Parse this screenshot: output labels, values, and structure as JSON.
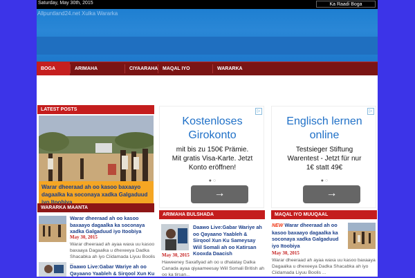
{
  "topbar": {
    "date": "Saturday, May 30th, 2015",
    "search_label": "Ka Raadi Boga"
  },
  "header": {
    "site_name": "Allpuntland24.net Xulka Wararka"
  },
  "nav": {
    "items": [
      "BOGA HORE",
      "ARIMAHA BULSHADA",
      "CIYAARAHA",
      "MAQAL IYO MUUQAAL",
      "WARARKA"
    ]
  },
  "latest": {
    "heading": "LATEST POSTS",
    "caption": "Warar dheeraad ah oo kasoo baxaayo dagaalka ka soconaya xadka Galgaduud iyo Itoobiya"
  },
  "ads": [
    {
      "title_line1": "Kostenloses",
      "title_line2": "Girokonto",
      "body_line1": "mit bis zu 150€ Prämie.",
      "body_line2": "Mit gratis Visa-Karte. Jetzt",
      "body_line3": "Konto eröffnen!",
      "button": "→"
    },
    {
      "title_line1": "Englisch lernen",
      "title_line2": "online",
      "body_line1": "Testsieger Stiftung",
      "body_line2": "Warentest - Jetzt für nur",
      "body_line3": "1€ statt 49€",
      "button": "→"
    }
  ],
  "wararka": {
    "heading": "WARARKA MAANTA",
    "items": [
      {
        "title": "Warar dheeraad ah oo kasoo baxaayo dagaalka ka soconaya xadka Galgaduud iyo Itoobiya",
        "date": "May 30, 2015",
        "excerpt": "Warar dheeraad ah ayaa waxa uu kasoo baxaaya Dagaalka u dhexeeya Dadka Shacabka ah iyo Ciidamada Liyuu Boolis ..."
      },
      {
        "title": "Daawo Live:Gabar Wariye ah oo Qayaano Yaableh & Sirqool Xun Ku",
        "date": "",
        "excerpt": ""
      }
    ]
  },
  "arimaha": {
    "heading": "ARIMAHA BULSHADA",
    "item": {
      "title": "Daawo Live:Gabar Wariye ah oo Qayaano Yaableh & Sirqool Xun Ku Sameysay Wiil Somali ah oo Katirsan Kooxda Daacish",
      "date": "May 30, 2015",
      "excerpt": "Haweeney Saxafiyad ah oo u dhalatay Dalka Canada ayaa qiyaameesay Wiil Somali British ah oo ka tirsan..."
    }
  },
  "maqal": {
    "heading": "MAQAL IYO MUUQAAL",
    "item": {
      "badge": "NEW",
      "title": "Warar dheeraad ah oo kasoo baxaayo dagaalka ka soconaya xadka Galgaduud iyo Itoobiya",
      "date": "May 30, 2015",
      "excerpt": "Warar dheeraad ah ayaa waxa uu kasoo baxaaya Dagaalka u dhexeeya Dadka Shacabka ah iyo Ciidamada Liyuu Boolis ..."
    }
  }
}
